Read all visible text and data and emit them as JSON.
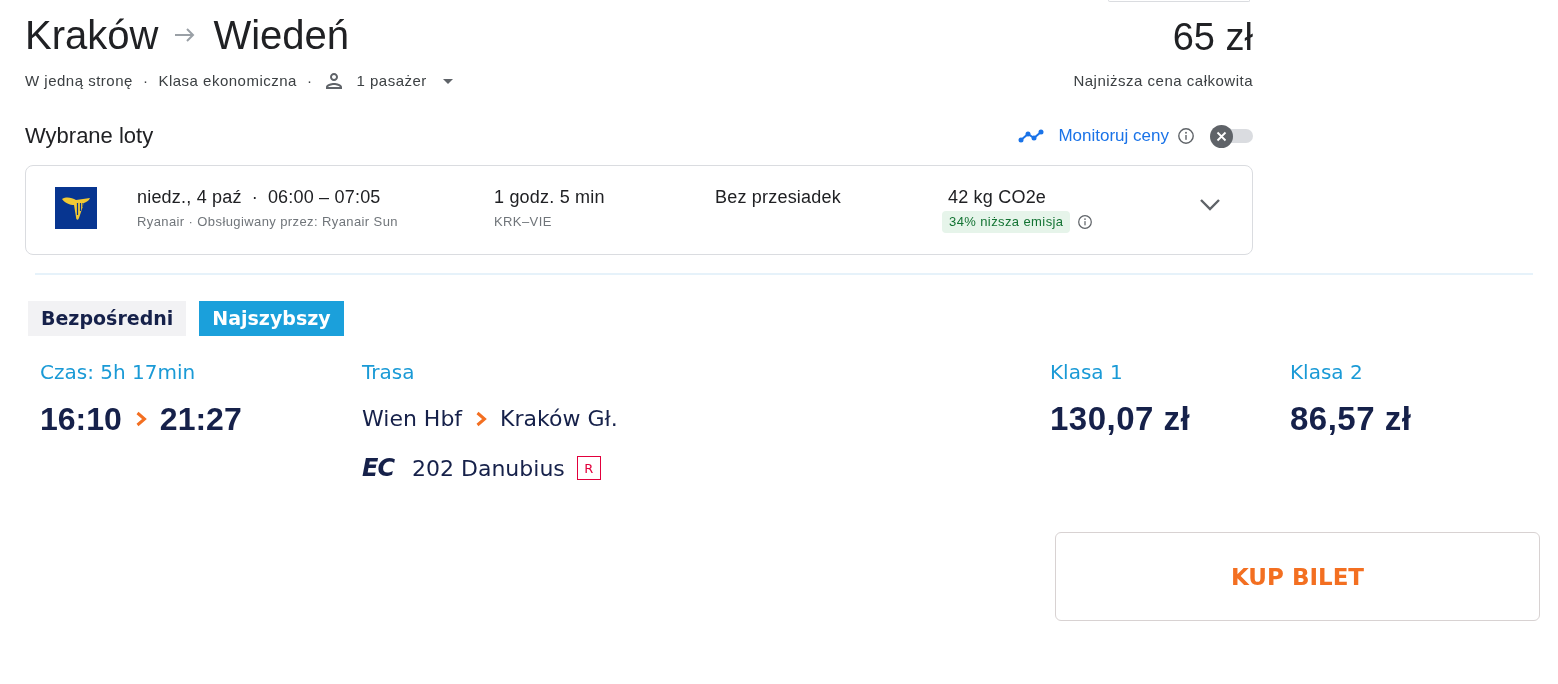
{
  "header": {
    "origin": "Kraków",
    "destination": "Wiedeń",
    "price": "65 zł",
    "price_caption": "Najniższa cena całkowita",
    "options": [
      {
        "label": "W jedną stronę",
        "separator": "·"
      },
      {
        "label": "Klasa ekonomiczna",
        "separator": "·"
      }
    ],
    "passengers": "1 pasażer"
  },
  "selected_flights": {
    "title": "Wybrane loty",
    "track_prices": {
      "label": "Monitoruj ceny",
      "on": false
    },
    "flights": [
      {
        "date": "niedz., 4 paź",
        "separator": "·",
        "times": "06:00 – 07:05",
        "airline": "Ryanair · Obsługiwany przez: Ryanair Sun",
        "duration": "1 godz. 5 min",
        "route": "KRK–VIE",
        "stops": "Bez przesiadek",
        "emissions": "42 kg CO2e",
        "emissions_badge": "34% niższa emisja",
        "expanded": false
      }
    ]
  },
  "train": {
    "tags": [
      {
        "label": "Bezpośredni",
        "color": "#f2f2f4"
      },
      {
        "label": "Najszybszy",
        "color": "#1ba0db"
      }
    ],
    "duration_label": "Czas: 5h 17min",
    "departure": "16:10",
    "arrival": "21:27",
    "route_label": "Trasa",
    "from_station": "Wien Hbf",
    "to_station": "Kraków Gł.",
    "category": "EC",
    "train_name": "202 Danubius",
    "reservation_mark": "R",
    "fares": [
      {
        "class": "Klasa 1",
        "price": "130,07 zł"
      },
      {
        "class": "Klasa 2",
        "price": "86,57 zł"
      }
    ],
    "buy_button": "KUP BILET"
  }
}
